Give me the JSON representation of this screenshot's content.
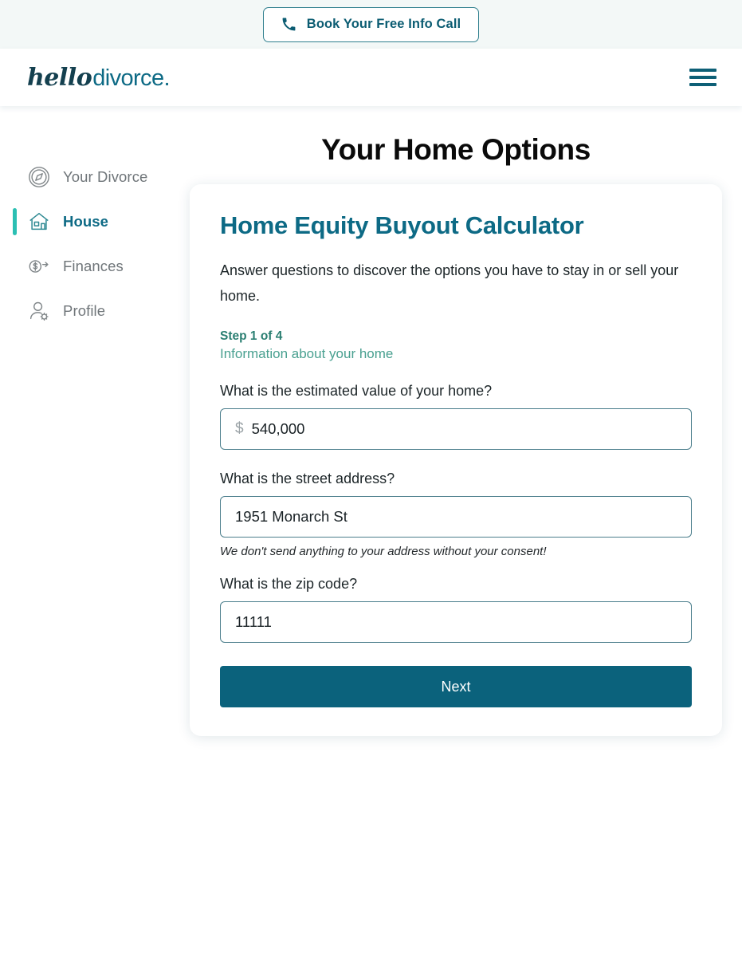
{
  "promo": {
    "button_label": "Book Your Free Info Call",
    "icon": "phone-icon"
  },
  "header": {
    "logo_primary": "hello",
    "logo_secondary": "divorce.",
    "menu_icon": "hamburger-menu-icon"
  },
  "sidebar": {
    "items": [
      {
        "label": "Your Divorce",
        "icon": "compass-icon",
        "active": false
      },
      {
        "label": "House",
        "icon": "house-icon",
        "active": true
      },
      {
        "label": "Finances",
        "icon": "dollar-transfer-icon",
        "active": false
      },
      {
        "label": "Profile",
        "icon": "person-gear-icon",
        "active": false
      }
    ]
  },
  "main": {
    "page_title": "Your Home Options",
    "card": {
      "title": "Home Equity Buyout Calculator",
      "description": "Answer questions to discover the options you have to stay in or sell your home.",
      "step_label": "Step 1 of 4",
      "step_sub": "Information about your home",
      "fields": [
        {
          "label": "What is the estimated value of your home?",
          "prefix": "$",
          "value": "540,000",
          "placeholder": "",
          "helper": ""
        },
        {
          "label": "What is the street address?",
          "prefix": "",
          "value": "1951 Monarch St",
          "placeholder": "",
          "helper": "We don't send anything to your address without your consent!"
        },
        {
          "label": "What is the zip code?",
          "prefix": "",
          "value": "11111",
          "placeholder": "",
          "helper": ""
        }
      ],
      "next_label": "Next"
    }
  },
  "colors": {
    "brand_teal": "#0d6a85",
    "button_teal": "#0b627c",
    "accent_green": "#2bbfb3",
    "step_green": "#2b7f72",
    "promo_bg": "#f3f8f7"
  }
}
